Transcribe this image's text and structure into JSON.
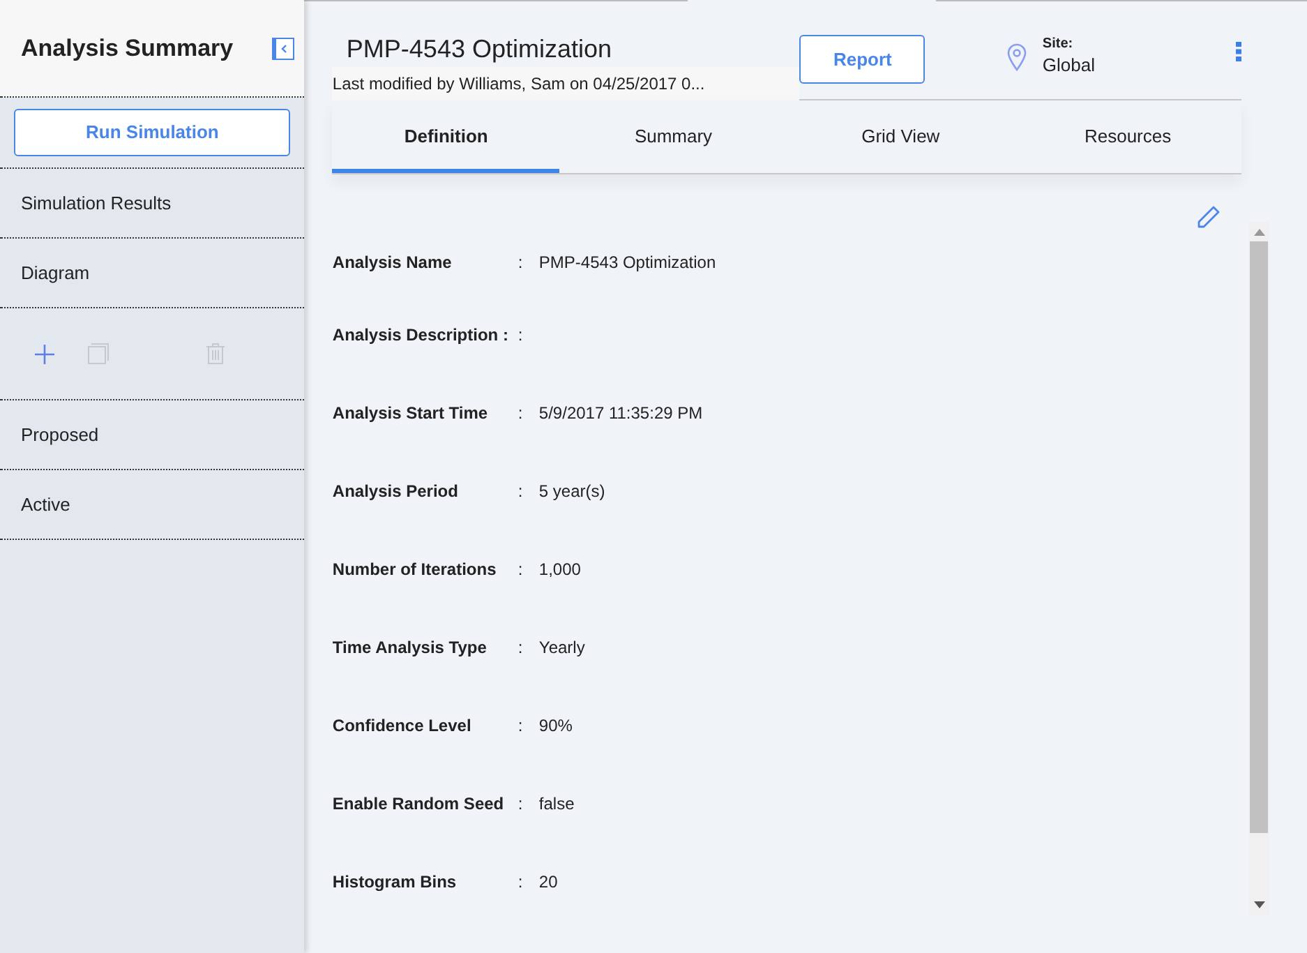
{
  "sidebar": {
    "title": "Analysis Summary",
    "run_button": "Run Simulation",
    "items": [
      {
        "label": "Simulation Results"
      },
      {
        "label": "Diagram"
      }
    ],
    "toolbar": [
      {
        "kind": "add",
        "disabled": false
      },
      {
        "kind": "copy",
        "disabled": true
      },
      {
        "kind": "delete",
        "disabled": true
      }
    ],
    "sections": [
      {
        "label": "Proposed"
      },
      {
        "label": "Active"
      }
    ]
  },
  "header": {
    "title": "PMP-4543 Optimization",
    "subtitle": "Last modified by Williams, Sam on 04/25/2017 0...",
    "report_button": "Report",
    "site_label": "Site:",
    "site_value": "Global"
  },
  "tabs": [
    {
      "label": "Definition",
      "selected": true
    },
    {
      "label": "Summary",
      "selected": false
    },
    {
      "label": "Grid View",
      "selected": false
    },
    {
      "label": "Resources",
      "selected": false
    }
  ],
  "fields": [
    {
      "label": "Analysis Name",
      "separator": ":",
      "value": "PMP-4543 Optimization"
    },
    {
      "label": "Analysis Description :",
      "separator": ":"
    },
    {
      "label": "Analysis Start Time",
      "separator": ":",
      "value": "5/9/2017 11:35:29 PM"
    },
    {
      "label": "Analysis Period",
      "separator": ":",
      "value": "5 year(s)"
    },
    {
      "label": "Number of Iterations",
      "separator": ":",
      "value": "1,000"
    },
    {
      "label": "Time Analysis Type",
      "separator": ":",
      "value": "Yearly"
    },
    {
      "label": "Confidence Level",
      "separator": ":",
      "value": "90%"
    },
    {
      "label": "Enable Random Seed",
      "separator": ":",
      "value": "false"
    },
    {
      "label": "Histogram Bins",
      "separator": ":",
      "value": "20"
    }
  ]
}
